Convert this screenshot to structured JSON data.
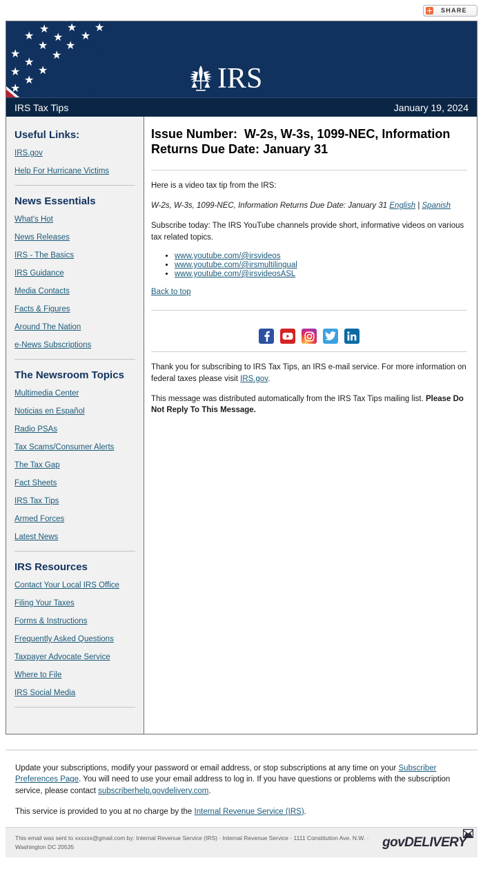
{
  "share": {
    "label": "SHARE",
    "icon": "plus-icon",
    "accent": "#ec6d3f"
  },
  "banner": {
    "logo_text": "IRS",
    "logo_emblem": "irs-eagle-scales-emblem",
    "flag_icon": "us-flag-graphic",
    "navy": "#11325e"
  },
  "date_bar": {
    "publication": "IRS Tax Tips",
    "date": "January 19, 2024",
    "background": "#0b2545"
  },
  "sidebar": {
    "sections": [
      {
        "heading": "Useful Links:",
        "links": [
          "IRS.gov",
          "Help For Hurricane Victims"
        ]
      },
      {
        "heading": "News Essentials",
        "links": [
          "What's Hot",
          "News Releases",
          "IRS - The Basics",
          "IRS Guidance",
          "Media Contacts",
          "Facts & Figures",
          "Around The Nation",
          "e-News Subscriptions"
        ]
      },
      {
        "heading": "The Newsroom Topics",
        "links": [
          "Multimedia Center",
          "Noticias en Español",
          "Radio PSAs",
          "Tax Scams/Consumer Alerts",
          "The Tax Gap",
          "Fact Sheets",
          "IRS Tax Tips",
          "Armed Forces",
          "Latest News"
        ]
      },
      {
        "heading": "IRS Resources",
        "links": [
          "Contact Your Local IRS Office",
          "Filing Your Taxes",
          "Forms & Instructions",
          "Frequently Asked Questions",
          "Taxpayer Advocate Service",
          "Where to File",
          "IRS Social Media"
        ]
      }
    ],
    "link_color": "#1a5a7a"
  },
  "main": {
    "issue_title": "Issue Number:  W-2s, W-3s, 1099-NEC, Information Returns Due Date: January 31",
    "intro": "Here is a video tax tip from the IRS:",
    "video_line": {
      "title": "W-2s, W-3s, 1099-NEC, Information Returns Due Date: January 31",
      "english": "English",
      "separator": "|",
      "spanish": "Spanish"
    },
    "subscribe": "Subscribe today: The IRS YouTube channels provide short, informative videos on various tax related topics.",
    "youtube_links": [
      "www.youtube.com/@irsvideos",
      "www.youtube.com/@irsmultilingual",
      "www.youtube.com/@irsvideosASL"
    ],
    "back_to_top": "Back to top",
    "social": [
      {
        "name": "facebook",
        "glyph": "f"
      },
      {
        "name": "youtube",
        "glyph": "▶"
      },
      {
        "name": "instagram",
        "glyph": "◎"
      },
      {
        "name": "twitter",
        "glyph": "ᵛ"
      },
      {
        "name": "linkedin",
        "glyph": "in"
      }
    ],
    "thanks_before": "Thank you for subscribing to IRS Tax Tips, an IRS e-mail service. For more information on federal taxes please visit ",
    "thanks_link": "IRS.gov",
    "thanks_after": ".",
    "auto_before": "This message was distributed automatically from the IRS Tax Tips mailing list. ",
    "auto_bold": "Please Do Not Reply To This Message."
  },
  "footer": {
    "update_before": "Update your subscriptions, modify your password or email address, or stop subscriptions at any time on your ",
    "update_link": "Subscriber Preferences Page",
    "update_middle": ". You will need to use your email address to log in. If you have questions or problems with the subscription service, please contact ",
    "update_link2": "subscriberhelp.govdelivery.com",
    "update_after": ".",
    "service_before": "This service is provided to you at no charge by the ",
    "service_link": "Internal Revenue Service (IRS)",
    "service_after": "."
  },
  "bottom": {
    "sent_text": "This email was sent to xxxxxx@gmail.com by: Internal Revenue Service (IRS) · Internal Revenue Service · 1111 Constitution Ave. N.W. · Washington DC 20535",
    "brand": "govDELIVERY"
  }
}
